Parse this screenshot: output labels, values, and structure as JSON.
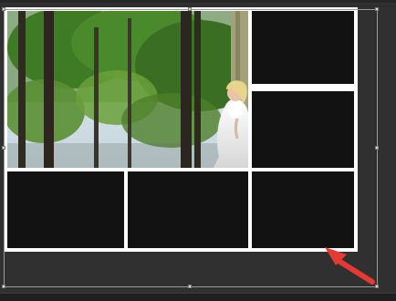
{
  "canvas": {
    "background": "#2d2d2d",
    "collage_border": "#ffffff",
    "empty_cell_fill": "#121212"
  },
  "collage": {
    "photo": {
      "subject": "bride-in-forest",
      "description_icon": "photo"
    },
    "cells": [
      {
        "id": "photo-cell",
        "filled": true
      },
      {
        "id": "top-right-cell",
        "filled": false
      },
      {
        "id": "middle-right-cell",
        "filled": false
      },
      {
        "id": "bottom-left-cell",
        "filled": false
      },
      {
        "id": "bottom-middle-cell",
        "filled": false
      },
      {
        "id": "bottom-right-cell",
        "filled": false
      }
    ]
  },
  "annotation": {
    "arrow_color": "#e53935",
    "arrow_icon": "pointer-arrow-icon"
  },
  "transform_box": {
    "line_color": "#9a9a9a",
    "handle_color": "#d8d8d8"
  }
}
